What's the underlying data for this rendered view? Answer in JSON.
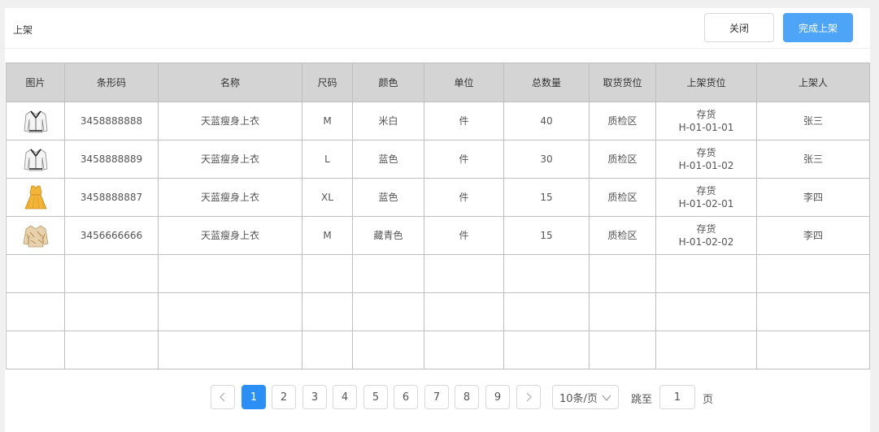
{
  "header": {
    "title": "上架",
    "close_label": "关闭",
    "finish_label": "完成上架",
    "accent": "#4ea5f7"
  },
  "table": {
    "columns": [
      "图片",
      "条形码",
      "名称",
      "尺码",
      "颜色",
      "单位",
      "总数量",
      "取货货位",
      "上架货位",
      "上架人"
    ],
    "rows": [
      {
        "image": "white-jacket-thumbnail",
        "barcode": "3458888888",
        "name": "天蓝瘦身上衣",
        "size": "M",
        "color": "米白",
        "unit": "件",
        "qty": "40",
        "pickup": "质检区",
        "shelf_type": "存货",
        "shelf_code": "H-01-01-01",
        "operator": "张三"
      },
      {
        "image": "white-jacket-thumbnail",
        "barcode": "3458888889",
        "name": "天蓝瘦身上衣",
        "size": "L",
        "color": "蓝色",
        "unit": "件",
        "qty": "30",
        "pickup": "质检区",
        "shelf_type": "存货",
        "shelf_code": "H-01-01-02",
        "operator": "张三"
      },
      {
        "image": "yellow-dress-thumbnail",
        "barcode": "3458888887",
        "name": "天蓝瘦身上衣",
        "size": "XL",
        "color": "蓝色",
        "unit": "件",
        "qty": "15",
        "pickup": "质检区",
        "shelf_type": "存货",
        "shelf_code": "H-01-02-01",
        "operator": "李四"
      },
      {
        "image": "beige-blouse-thumbnail",
        "barcode": "3456666666",
        "name": "天蓝瘦身上衣",
        "size": "M",
        "color": "藏青色",
        "unit": "件",
        "qty": "15",
        "pickup": "质检区",
        "shelf_type": "存货",
        "shelf_code": "H-01-02-02",
        "operator": "李四"
      }
    ]
  },
  "pagination": {
    "pages": [
      "1",
      "2",
      "3",
      "4",
      "5",
      "6",
      "7",
      "8",
      "9"
    ],
    "current": "1",
    "page_size": "10条/页",
    "jump_label": "跳至",
    "jump_value": "1",
    "page_suffix": "页",
    "active_color": "#2b8ff5"
  }
}
